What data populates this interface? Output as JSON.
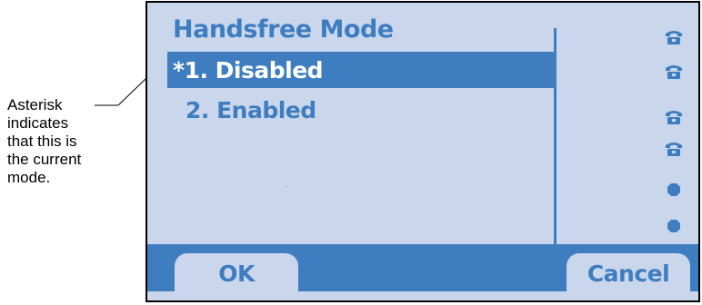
{
  "annotation": {
    "text": "Asterisk\nindicates\nthat this is\nthe current\nmode."
  },
  "screen": {
    "title": "Handsfree Mode",
    "menu": [
      {
        "label": "*1. Disabled",
        "selected": true
      },
      {
        "label": "2. Enabled",
        "selected": false
      }
    ],
    "side_icons": [
      "phone-icon",
      "phone-icon",
      "phone-icon",
      "phone-icon",
      "bullet-icon",
      "bullet-icon"
    ],
    "softkeys": {
      "ok": "OK",
      "cancel": "Cancel"
    },
    "colors": {
      "background": "#c9d6eb",
      "accent": "#3e7dc0",
      "selected_text": "#ffffff"
    }
  }
}
